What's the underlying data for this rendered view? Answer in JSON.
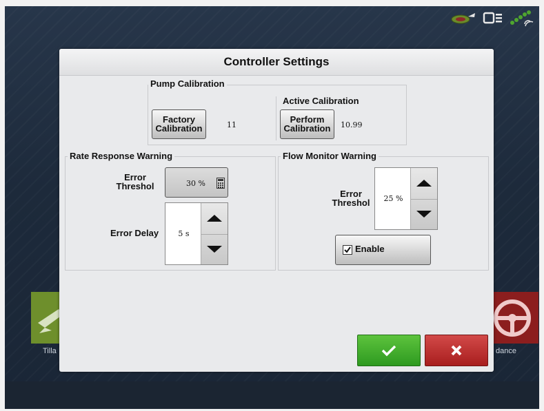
{
  "background": {
    "left_app_label": "Tilla",
    "right_app_label": "dance"
  },
  "dialog": {
    "title": "Controller Settings",
    "pump_calibration": {
      "legend": "Pump Calibration",
      "factory_button": [
        "Factory",
        "Calibration"
      ],
      "factory_value": "11",
      "active_label": "Active Calibration",
      "perform_button": [
        "Perform",
        "Calibration"
      ],
      "active_value": "10.99"
    },
    "rate_response": {
      "legend": "Rate Response Warning",
      "error_threshold_label": [
        "Error",
        "Threshol"
      ],
      "error_threshold_value": "30 %",
      "error_delay_label": "Error Delay",
      "error_delay_value": "5 s"
    },
    "flow_monitor": {
      "legend": "Flow Monitor Warning",
      "error_threshold_label": [
        "Error",
        "Threshol"
      ],
      "error_threshold_value": "25 %",
      "enable_label": "Enable",
      "enable_checked": true
    }
  },
  "colors": {
    "ok": "#3fae2a",
    "cancel": "#bc2d2c",
    "background_left_app": "#6e8f2c",
    "background_right_app": "#8c1e1e"
  },
  "icons": {
    "calculator": "calculator-icon",
    "ok": "checkmark-icon",
    "cancel": "x-icon",
    "status": [
      "gps-satellite-icon",
      "display-icon",
      "signal-icon"
    ]
  }
}
